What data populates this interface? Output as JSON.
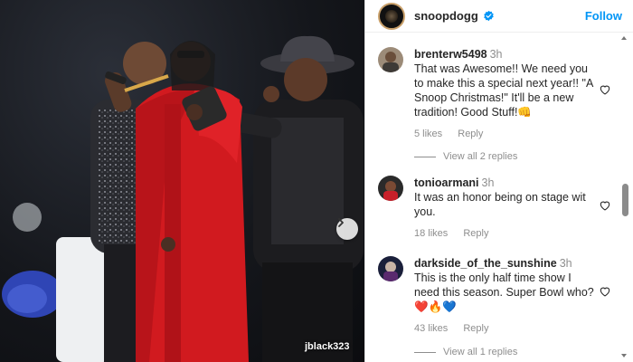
{
  "post": {
    "photo_tag": "jblack323",
    "next_icon": "chevron-right-icon"
  },
  "header": {
    "username": "snoopdogg",
    "verified_icon": "verified-badge-icon",
    "follow_label": "Follow",
    "accent_color": "#0095f6"
  },
  "comments": [
    {
      "username": "brenterw5498",
      "time": "3h",
      "text": "That was Awesome!! We need you to make this a special next year!! \"A Snoop Christmas!\" It'll be a new tradition! Good Stuff!👊",
      "likes": "5 likes",
      "reply_label": "Reply",
      "view_replies": "View all 2 replies"
    },
    {
      "username": "tonioarmani",
      "time": "3h",
      "text": "It was an honor being on stage wit you.",
      "likes": "18 likes",
      "reply_label": "Reply"
    },
    {
      "username": "darkside_of_the_sunshine",
      "time": "3h",
      "text": "This is the only half time show I need this season. Super Bowl who? ❤️🔥💙",
      "likes": "43 likes",
      "reply_label": "Reply",
      "view_replies": "View all 1 replies"
    }
  ]
}
